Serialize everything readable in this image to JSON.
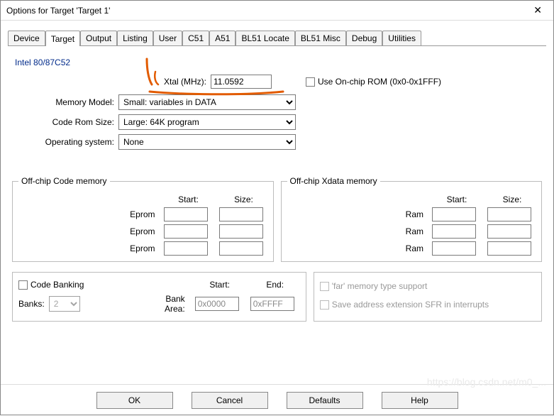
{
  "window": {
    "title": "Options for Target 'Target 1'"
  },
  "tabs": [
    "Device",
    "Target",
    "Output",
    "Listing",
    "User",
    "C51",
    "A51",
    "BL51 Locate",
    "BL51 Misc",
    "Debug",
    "Utilities"
  ],
  "active_tab_index": 1,
  "chip": "Intel 80/87C52",
  "xtal": {
    "label": "Xtal (MHz):",
    "value": "11.0592"
  },
  "onchip_rom": {
    "label": "Use On-chip ROM (0x0-0x1FFF)",
    "checked": false
  },
  "memory_model": {
    "label": "Memory Model:",
    "value": "Small: variables in DATA"
  },
  "code_rom_size": {
    "label": "Code Rom Size:",
    "value": "Large: 64K program"
  },
  "operating_system": {
    "label": "Operating system:",
    "value": "None"
  },
  "code_mem": {
    "legend": "Off-chip Code memory",
    "start_hdr": "Start:",
    "size_hdr": "Size:",
    "rows": [
      {
        "label": "Eprom",
        "start": "",
        "size": ""
      },
      {
        "label": "Eprom",
        "start": "",
        "size": ""
      },
      {
        "label": "Eprom",
        "start": "",
        "size": ""
      }
    ]
  },
  "xdata_mem": {
    "legend": "Off-chip Xdata memory",
    "start_hdr": "Start:",
    "size_hdr": "Size:",
    "rows": [
      {
        "label": "Ram",
        "start": "",
        "size": ""
      },
      {
        "label": "Ram",
        "start": "",
        "size": ""
      },
      {
        "label": "Ram",
        "start": "",
        "size": ""
      }
    ]
  },
  "code_banking": {
    "label": "Code Banking",
    "checked": false,
    "banks_label": "Banks:",
    "banks_value": "2",
    "bank_area_label": "Bank Area:",
    "start_hdr": "Start:",
    "end_hdr": "End:",
    "start": "0x0000",
    "end": "0xFFFF"
  },
  "right_box": {
    "far_label": "'far' memory type support",
    "save_label": "Save address extension SFR in interrupts"
  },
  "buttons": {
    "ok": "OK",
    "cancel": "Cancel",
    "defaults": "Defaults",
    "help": "Help"
  },
  "watermark": "https://blog.csdn.net/m0_..."
}
